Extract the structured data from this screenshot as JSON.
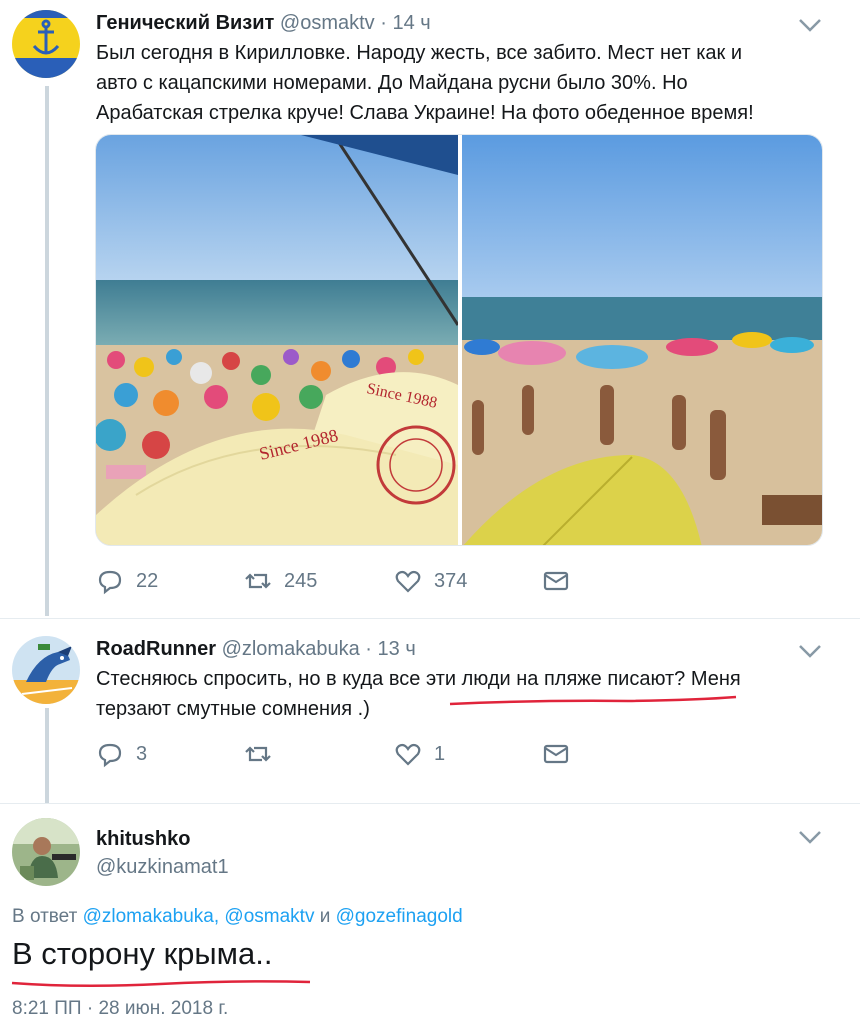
{
  "tweet1": {
    "name": "Генический Визит",
    "handle": "@osmaktv",
    "time": "14 ч",
    "line1": "Был сегодня в Кирилловке. Народу жесть, все забито. Мест нет как и",
    "line2": "авто с кацапскими номерами. До Майдана русни было 30%. Но",
    "line3": "Арабатская стрелка круче! Слава Украине! На фото обеденное время!",
    "replies": "22",
    "retweets": "245",
    "likes": "374"
  },
  "tweet2": {
    "name": "RoadRunner",
    "handle": "@zlomakabuka",
    "time": "13 ч",
    "line1": "Стесняюсь спросить, но в куда все эти люди на пляже писают? Меня",
    "line2": "терзают смутные сомнения .)",
    "replies": "3",
    "retweets": "",
    "likes": "1"
  },
  "tweet3": {
    "name": "khitushko",
    "handle": "@kuzkinamat1",
    "reply_prefix": "В ответ",
    "reply_link1": "@zlomakabuka,",
    "reply_link2": "@osmaktv",
    "reply_and": "и",
    "reply_link3": "@gozefinagold",
    "text": "В сторону крыма..",
    "timestamp": "8:21 ПП · 28 июн. 2018 г."
  },
  "icons": {
    "reply": "reply-icon",
    "retweet": "retweet-icon",
    "like": "heart-icon",
    "dm": "envelope-icon",
    "caret": "chevron-down-icon"
  },
  "colors": {
    "link": "#1da1f2",
    "muted": "#657786",
    "underline": "#e0245e"
  }
}
